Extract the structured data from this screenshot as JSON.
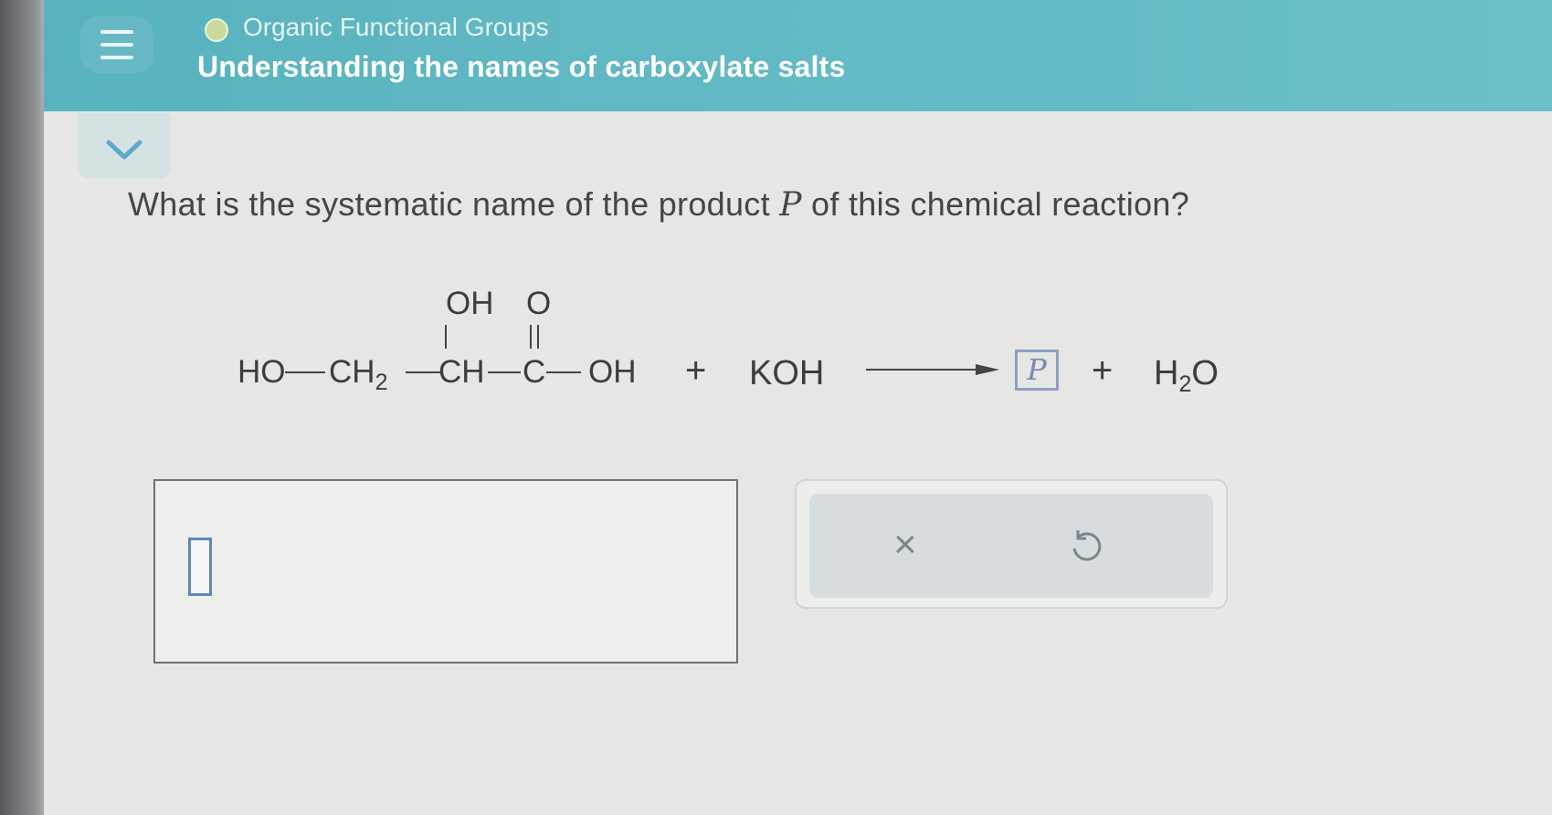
{
  "header": {
    "category": "Organic Functional Groups",
    "title": "Understanding the names of carboxylate salts"
  },
  "question": {
    "prefix": "What is the systematic name of the product ",
    "variable": "P",
    "suffix": " of this chemical reaction?"
  },
  "reaction": {
    "ho": "HO",
    "ch": "CH",
    "sub2": "2",
    "ch_mid": "CH",
    "c": "C",
    "oh_end": "OH",
    "oh_top": "OH",
    "o_top": "O",
    "plus1": "+",
    "reagent": "KOH",
    "product": "P",
    "plus2": "+",
    "water_h": "H",
    "water_sub": "2",
    "water_o": "O"
  },
  "answer": {
    "value": ""
  },
  "tools": {
    "clear_symbol": "×",
    "undo_symbol": "↺"
  },
  "icons": {
    "menu": "hamburger-menu-icon",
    "collapse": "chevron-down-icon",
    "status": "progress-dot-icon"
  },
  "colors": {
    "header": "#62b9c4",
    "status_dot": "#c8d99a",
    "product_box": "#8da0c2"
  }
}
